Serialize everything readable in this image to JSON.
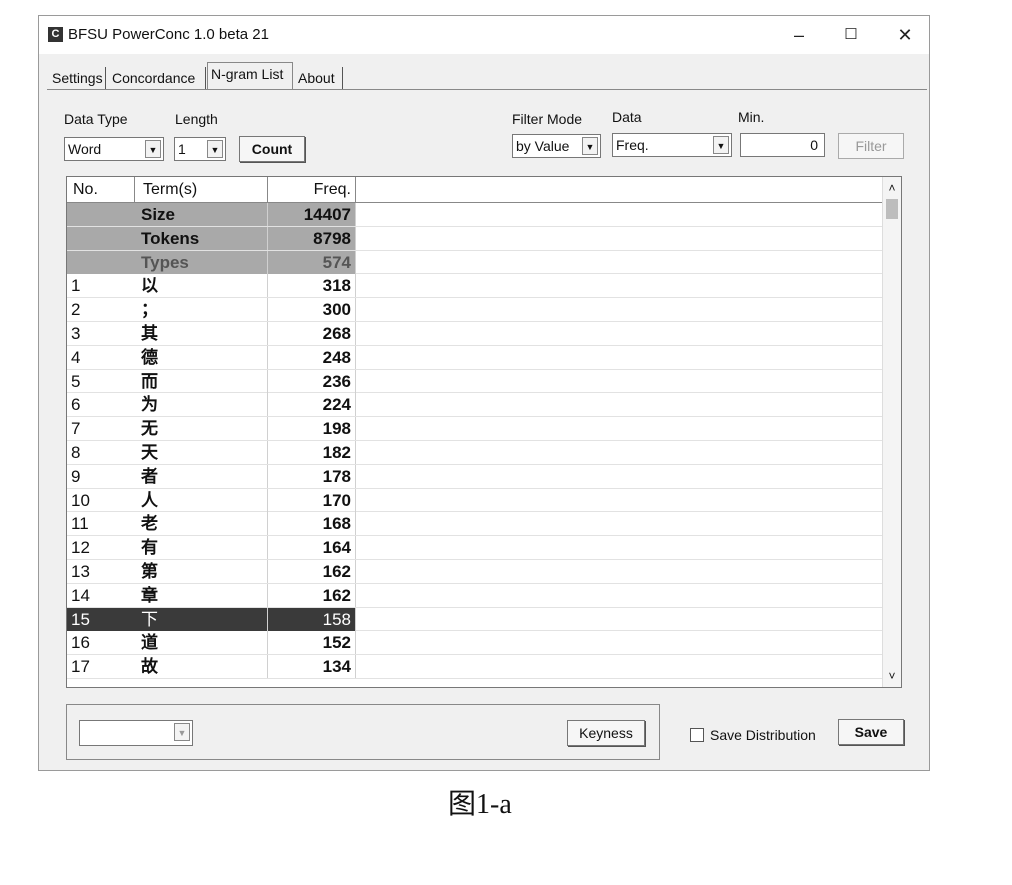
{
  "window": {
    "title": "BFSU PowerConc 1.0 beta 21",
    "app_icon": "C",
    "minimize_glyph": "–",
    "maximize_glyph": "☐",
    "close_glyph": "✕"
  },
  "tabs": [
    {
      "label": "Settings"
    },
    {
      "label": "Concordance"
    },
    {
      "label": "N-gram List",
      "active": true
    },
    {
      "label": "About"
    }
  ],
  "controls": {
    "data_type_label": "Data Type",
    "data_type_value": "Word",
    "length_label": "Length",
    "length_value": "1",
    "count_label": "Count",
    "filter_mode_label": "Filter Mode",
    "filter_mode_value": "by Value",
    "data_label": "Data",
    "data_value": "Freq.",
    "min_label": "Min.",
    "min_value": "0",
    "filter_label": "Filter"
  },
  "table": {
    "headers": {
      "no": "No.",
      "term": "Term(s)",
      "freq": "Freq."
    },
    "summary": [
      {
        "term": "Size",
        "freq": "14407"
      },
      {
        "term": "Tokens",
        "freq": "8798"
      },
      {
        "term": "Types",
        "freq": "574"
      }
    ],
    "rows": [
      {
        "no": "1",
        "term": "以",
        "freq": "318"
      },
      {
        "no": "2",
        "term": "；",
        "freq": "300"
      },
      {
        "no": "3",
        "term": "其",
        "freq": "268"
      },
      {
        "no": "4",
        "term": "德",
        "freq": "248"
      },
      {
        "no": "5",
        "term": "而",
        "freq": "236"
      },
      {
        "no": "6",
        "term": "为",
        "freq": "224"
      },
      {
        "no": "7",
        "term": "无",
        "freq": "198"
      },
      {
        "no": "8",
        "term": "天",
        "freq": "182"
      },
      {
        "no": "9",
        "term": "者",
        "freq": "178"
      },
      {
        "no": "10",
        "term": "人",
        "freq": "170"
      },
      {
        "no": "11",
        "term": "老",
        "freq": "168"
      },
      {
        "no": "12",
        "term": "有",
        "freq": "164"
      },
      {
        "no": "13",
        "term": "第",
        "freq": "162"
      },
      {
        "no": "14",
        "term": "章",
        "freq": "162"
      },
      {
        "no": "15",
        "term": "下",
        "freq": "158"
      },
      {
        "no": "16",
        "term": "道",
        "freq": "152"
      },
      {
        "no": "17",
        "term": "故",
        "freq": "134"
      }
    ],
    "selected_no": "15"
  },
  "bottom": {
    "combo_value": "",
    "keyness_label": "Keyness",
    "save_distribution_label": "Save Distribution",
    "save_label": "Save"
  },
  "caption": "图1-a"
}
